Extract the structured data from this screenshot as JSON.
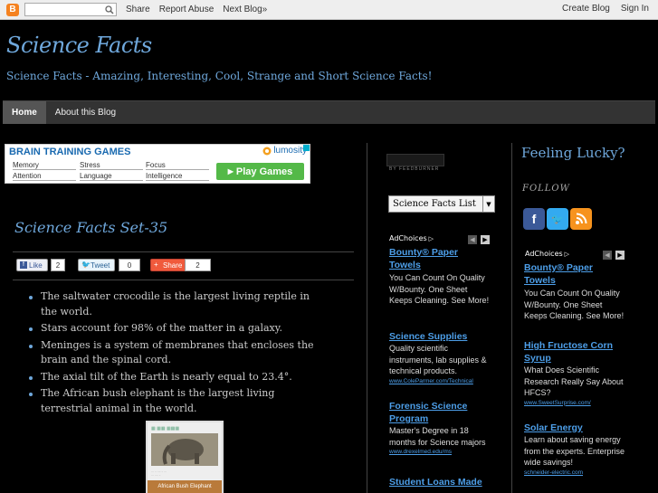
{
  "navbar": {
    "logo_letter": "B",
    "share": "Share",
    "report": "Report Abuse",
    "next": "Next Blog»",
    "create": "Create Blog",
    "signin": "Sign In"
  },
  "header": {
    "title": "Science Facts",
    "description": "Science Facts - Amazing, Interesting, Cool, Strange and Short Science Facts!"
  },
  "tabs": [
    {
      "label": "Home",
      "active": true
    },
    {
      "label": "About this Blog",
      "active": false
    }
  ],
  "ad_banner": {
    "title": "BRAIN TRAINING GAMES",
    "brand": "lumosity",
    "categories": [
      "Memory",
      "Stress",
      "Focus",
      "Attention",
      "Language",
      "Intelligence"
    ],
    "button": "Play Games"
  },
  "post": {
    "title": "Science Facts Set-35",
    "like_label": "Like",
    "like_count": "2",
    "tweet_label": "Tweet",
    "tweet_count": "0",
    "share_label": "Share",
    "share_count": "2",
    "facts": [
      "The saltwater crocodile is the largest living reptile in the world.",
      "Stars account for 98% of the matter in a galaxy.",
      "Meninges is a system of membranes that encloses the brain and the spinal cord.",
      "The axial tilt of the Earth is nearly equal to 23.4°.",
      "The African bush elephant is the largest living terrestrial animal in the world."
    ],
    "image_caption": "African Bush Elephant"
  },
  "sidebar1": {
    "feed_label": "BY FEEDBURNER",
    "select_value": "Science Facts List",
    "adchoices": "AdChoices",
    "ads": [
      {
        "title": "Bounty® Paper Towels",
        "text": "You Can Count On Quality W/Bounty. One Sheet Keeps Cleaning. See More!",
        "url": ""
      },
      {
        "title": "Science Supplies",
        "text": "Quality scientific instruments, lab supplies & technical products.",
        "url": "www.ColeParmer.com/Technical"
      },
      {
        "title": "Forensic Science Program",
        "text": "Master's Degree in 18 months for Science majors",
        "url": "www.drexelmed.edu/ms"
      },
      {
        "title": "Student Loans Made",
        "text": "",
        "url": ""
      }
    ]
  },
  "sidebar2": {
    "lucky": "Feeling Lucky?",
    "follow": "FOLLOW",
    "adchoices": "AdChoices",
    "ads": [
      {
        "title": "Bounty® Paper Towels",
        "text": "You Can Count On Quality W/Bounty. One Sheet Keeps Cleaning. See More!",
        "url": ""
      },
      {
        "title": "High Fructose Corn Syrup",
        "text": "What Does Scientific Research Really Say About HFCS?",
        "url": "www.SweetSurprise.com/"
      },
      {
        "title": "Solar Energy",
        "text": "Learn about saving energy from the experts. Enterprise wide savings!",
        "url": "schneider-electric.com"
      }
    ]
  }
}
